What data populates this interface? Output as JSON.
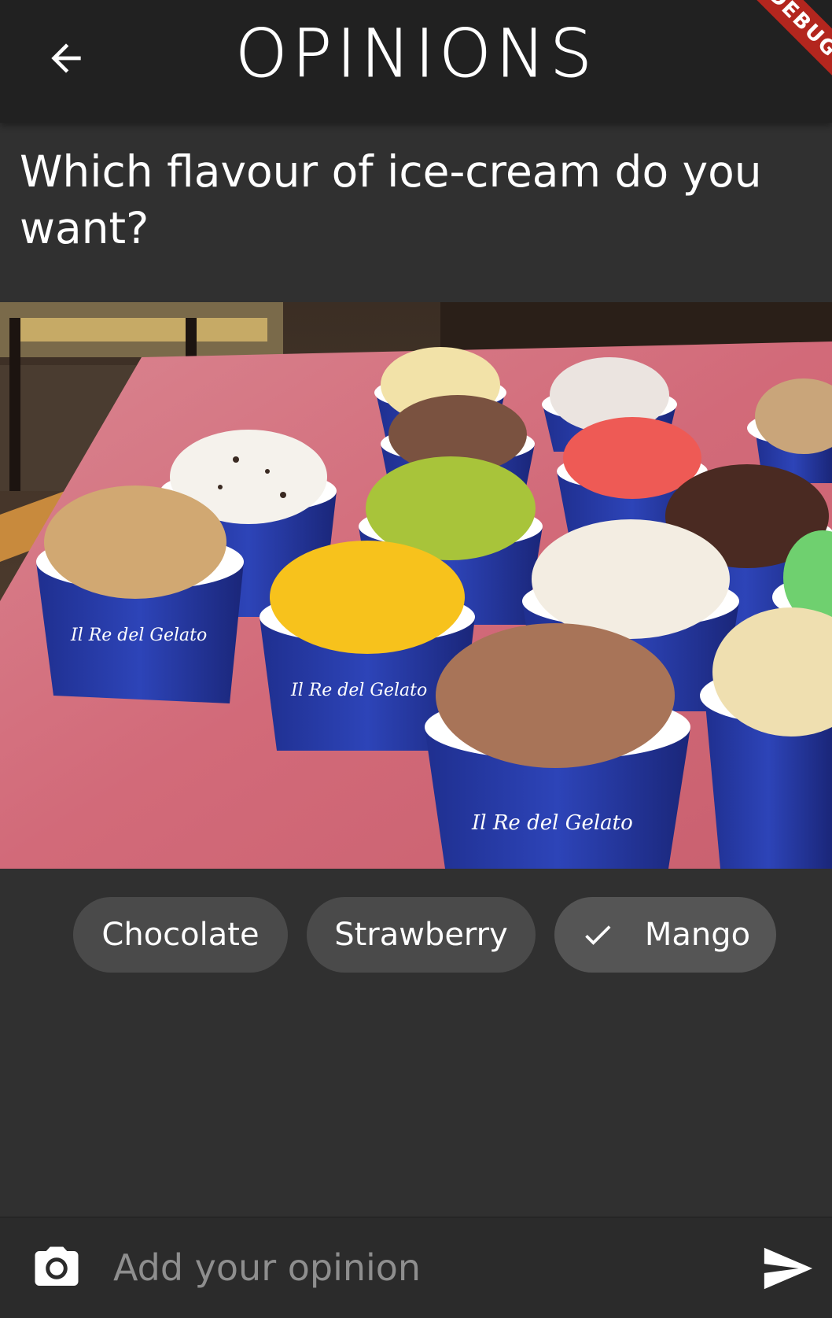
{
  "appbar": {
    "title": "OPINIONS",
    "back_icon": "arrow-back-icon",
    "debug_banner": "DEBUG"
  },
  "question": {
    "text": "Which flavour of ice-cream do you want?"
  },
  "image": {
    "subject": "ice-cream-cups-photo"
  },
  "options": [
    {
      "label": "Chocolate",
      "selected": false
    },
    {
      "label": "Strawberry",
      "selected": false
    },
    {
      "label": "Mango",
      "selected": true
    }
  ],
  "composer": {
    "placeholder": "Add your opinion",
    "value": "",
    "camera_icon": "camera-icon",
    "send_icon": "send-icon"
  },
  "colors": {
    "background": "#303030",
    "appbar": "#212121",
    "chip": "#4a4a4a",
    "chip_selected": "#555555",
    "placeholder": "#8e8e8e"
  }
}
